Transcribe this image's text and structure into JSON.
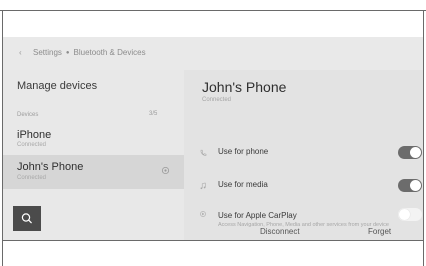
{
  "header": {
    "back_icon": "chevron-left-icon",
    "crumbs": [
      "Settings",
      "Bluetooth & Devices"
    ]
  },
  "sidebar": {
    "title": "Manage devices",
    "devices_label": "Devices",
    "devices_count": "3/5",
    "devices": [
      {
        "name": "iPhone",
        "status": "Connected",
        "selected": false
      },
      {
        "name": "John's Phone",
        "status": "Connected",
        "selected": true
      }
    ],
    "search_icon": "search-icon"
  },
  "detail": {
    "title": "John's Phone",
    "status": "Connected",
    "options": [
      {
        "label": "Use for phone",
        "icon": "phone-icon",
        "enabled": true
      },
      {
        "label": "Use for media",
        "icon": "music-note-icon",
        "enabled": true
      },
      {
        "label": "Use for Apple CarPlay",
        "icon": "carplay-icon",
        "enabled": false,
        "description": "Access Navigation, Phone, Media and other services from your device"
      }
    ],
    "disconnect_label": "Disconnect",
    "forget_label": "Forget"
  },
  "colors": {
    "panel_left": "#e8e8e8",
    "panel_right": "#e3e3e3",
    "selected_row": "#d6d6d6",
    "toggle_on": "#6c6c6c",
    "search_button": "#4b4b4b"
  }
}
